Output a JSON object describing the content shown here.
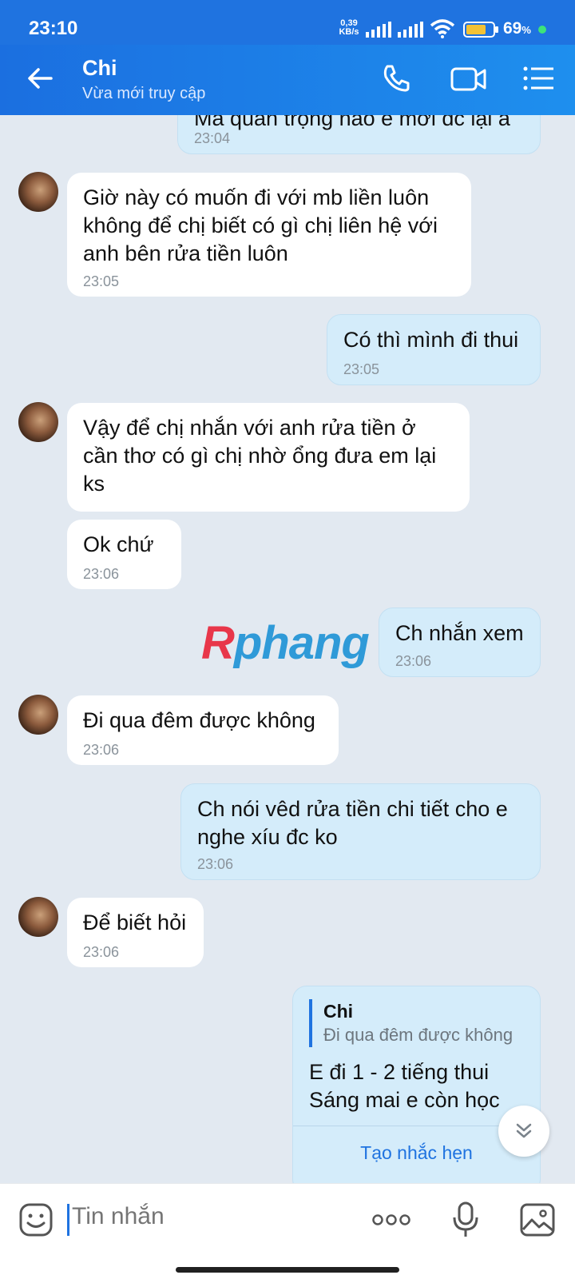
{
  "status_bar": {
    "time": "23:10",
    "net_speed": "0,39",
    "net_unit": "KB/s",
    "battery_percent": "69",
    "battery_unit": "%"
  },
  "header": {
    "contact_name": "Chi",
    "status": "Vừa mới truy cập",
    "icons": [
      "back-arrow-icon",
      "phone-icon",
      "video-call-icon",
      "menu-icon"
    ]
  },
  "messages": [
    {
      "dir": "out",
      "text": "Mà quan trọng nào e mới đc lại á",
      "time": "23:04"
    },
    {
      "dir": "in",
      "text": "Giờ này có muốn đi với mb liền luôn không để chị biết có gì chị liên hệ với anh bên rửa tiền luôn",
      "time": "23:05"
    },
    {
      "dir": "out",
      "text": "Có thì mình đi thui",
      "time": "23:05"
    },
    {
      "dir": "in",
      "text": "Vậy để chị nhắn với anh rửa tiền ở cần thơ có gì chị nhờ ổng đưa em lại ks",
      "time": ""
    },
    {
      "dir": "in",
      "text": "Ok chứ",
      "time": "23:06"
    },
    {
      "dir": "out",
      "text": "Ch nhắn xem",
      "time": "23:06"
    },
    {
      "dir": "in",
      "text": "Đi qua đêm được không",
      "time": "23:06"
    },
    {
      "dir": "out",
      "text": "Ch nói vêd rửa tiền chi tiết cho e nghe xíu đc ko",
      "time": "23:06"
    },
    {
      "dir": "in",
      "text": "Để biết hỏi",
      "time": "23:06"
    },
    {
      "dir": "out",
      "quote_name": "Chi",
      "quote_text": "Đi qua đêm được không",
      "line1": "E đi 1 - 2 tiếng thui",
      "line2": "Sáng mai e còn học",
      "action": "Tạo nhắc hẹn"
    }
  ],
  "watermark": {
    "first": "R",
    "rest": "phang"
  },
  "composer": {
    "placeholder": "Tin nhắn",
    "icons": [
      "emoji-icon",
      "more-icon",
      "microphone-icon",
      "gallery-icon"
    ]
  },
  "colors": {
    "header": "#1f73e0",
    "outgoing_bubble": "#d4ecfa",
    "incoming_bubble": "#ffffff",
    "background": "#e2e9f1"
  }
}
